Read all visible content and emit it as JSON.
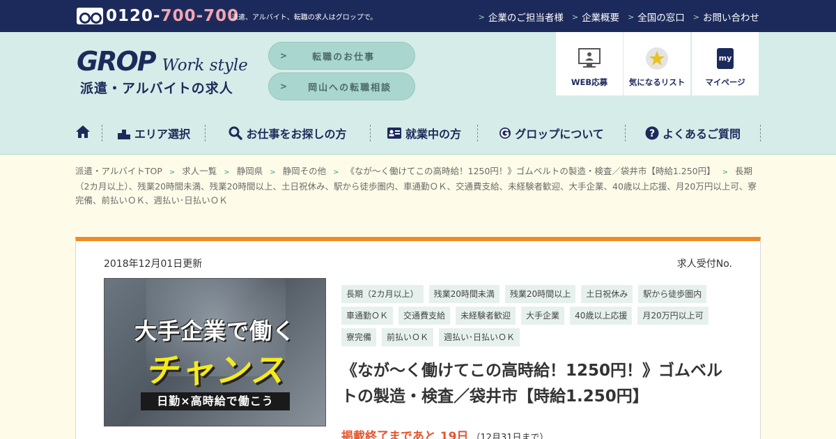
{
  "topbar": {
    "phone_prefix": "0120-",
    "phone_number": "700-700",
    "tagline": "派遣、アルバイト、転職の求人はグロップで。",
    "links": [
      "企業のご担当者様",
      "企業概要",
      "全国の窓口",
      "お問い合わせ"
    ]
  },
  "header": {
    "logo": "GROP",
    "logo_sub": "Work style",
    "logo_tagline": "派遣・アルバイトの求人",
    "buttons": [
      "転職のお仕事",
      "岡山への転職相談"
    ],
    "icons": [
      {
        "label": "WEB応募",
        "icon": "web-apply-icon"
      },
      {
        "label": "気になるリスト",
        "icon": "star-icon"
      },
      {
        "label": "マイページ",
        "icon": "my-page-icon"
      }
    ]
  },
  "nav": {
    "home_icon": "home-icon",
    "items": [
      {
        "label": "エリア選択",
        "icon": "area-icon"
      },
      {
        "label": "お仕事をお探しの方",
        "icon": "search-icon"
      },
      {
        "label": "就業中の方",
        "icon": "id-card-icon"
      },
      {
        "label": "グロップについて",
        "icon": "grop-icon"
      },
      {
        "label": "よくあるご質問",
        "icon": "question-icon"
      }
    ]
  },
  "breadcrumb": [
    "派遣・アルバイトTOP",
    "求人一覧",
    "静岡県",
    "静岡その他",
    "《なが～く働けてこの高時給！1250円！》ゴムベルトの製造・検査／袋井市【時給1.250円】",
    "長期（2カ月以上）、残業20時間未満、残業20時間以上、土日祝休み、駅から徒歩圏内、車通勤ＯＫ、交通費支給、未経験者歓迎、大手企業、40歳以上応援、月20万円以上可、寮完備、前払いＯＫ、週払い･日払いＯＫ"
  ],
  "job": {
    "updated": "2018年12月01日更新",
    "job_no_label": "求人受付No.",
    "banner": {
      "line1": "大手企業で働く",
      "line2": "チャンス",
      "line3": "日勤×高時給で働こう"
    },
    "tags": [
      "長期（2カ月以上）",
      "残業20時間未満",
      "残業20時間以上",
      "土日祝休み",
      "駅から徒歩圏内",
      "車通勤ＯＫ",
      "交通費支給",
      "未経験者歓迎",
      "大手企業",
      "40歳以上応援",
      "月20万円以上可",
      "寮完備",
      "前払いＯＫ",
      "週払い･日払いＯＫ"
    ],
    "title": "《なが～く働けてこの高時給！1250円！》ゴムベルトの製造・検査／袋井市【時給1.250円】",
    "deadline_main": "掲載終了まであと 19日",
    "deadline_sub": "（12月31日まで）"
  },
  "colors": {
    "navy": "#1c2a5b",
    "header_bg": "#d6ece8",
    "page_bg": "#fefce8",
    "accent_orange": "#f08a24",
    "deadline_red": "#e4572e"
  }
}
